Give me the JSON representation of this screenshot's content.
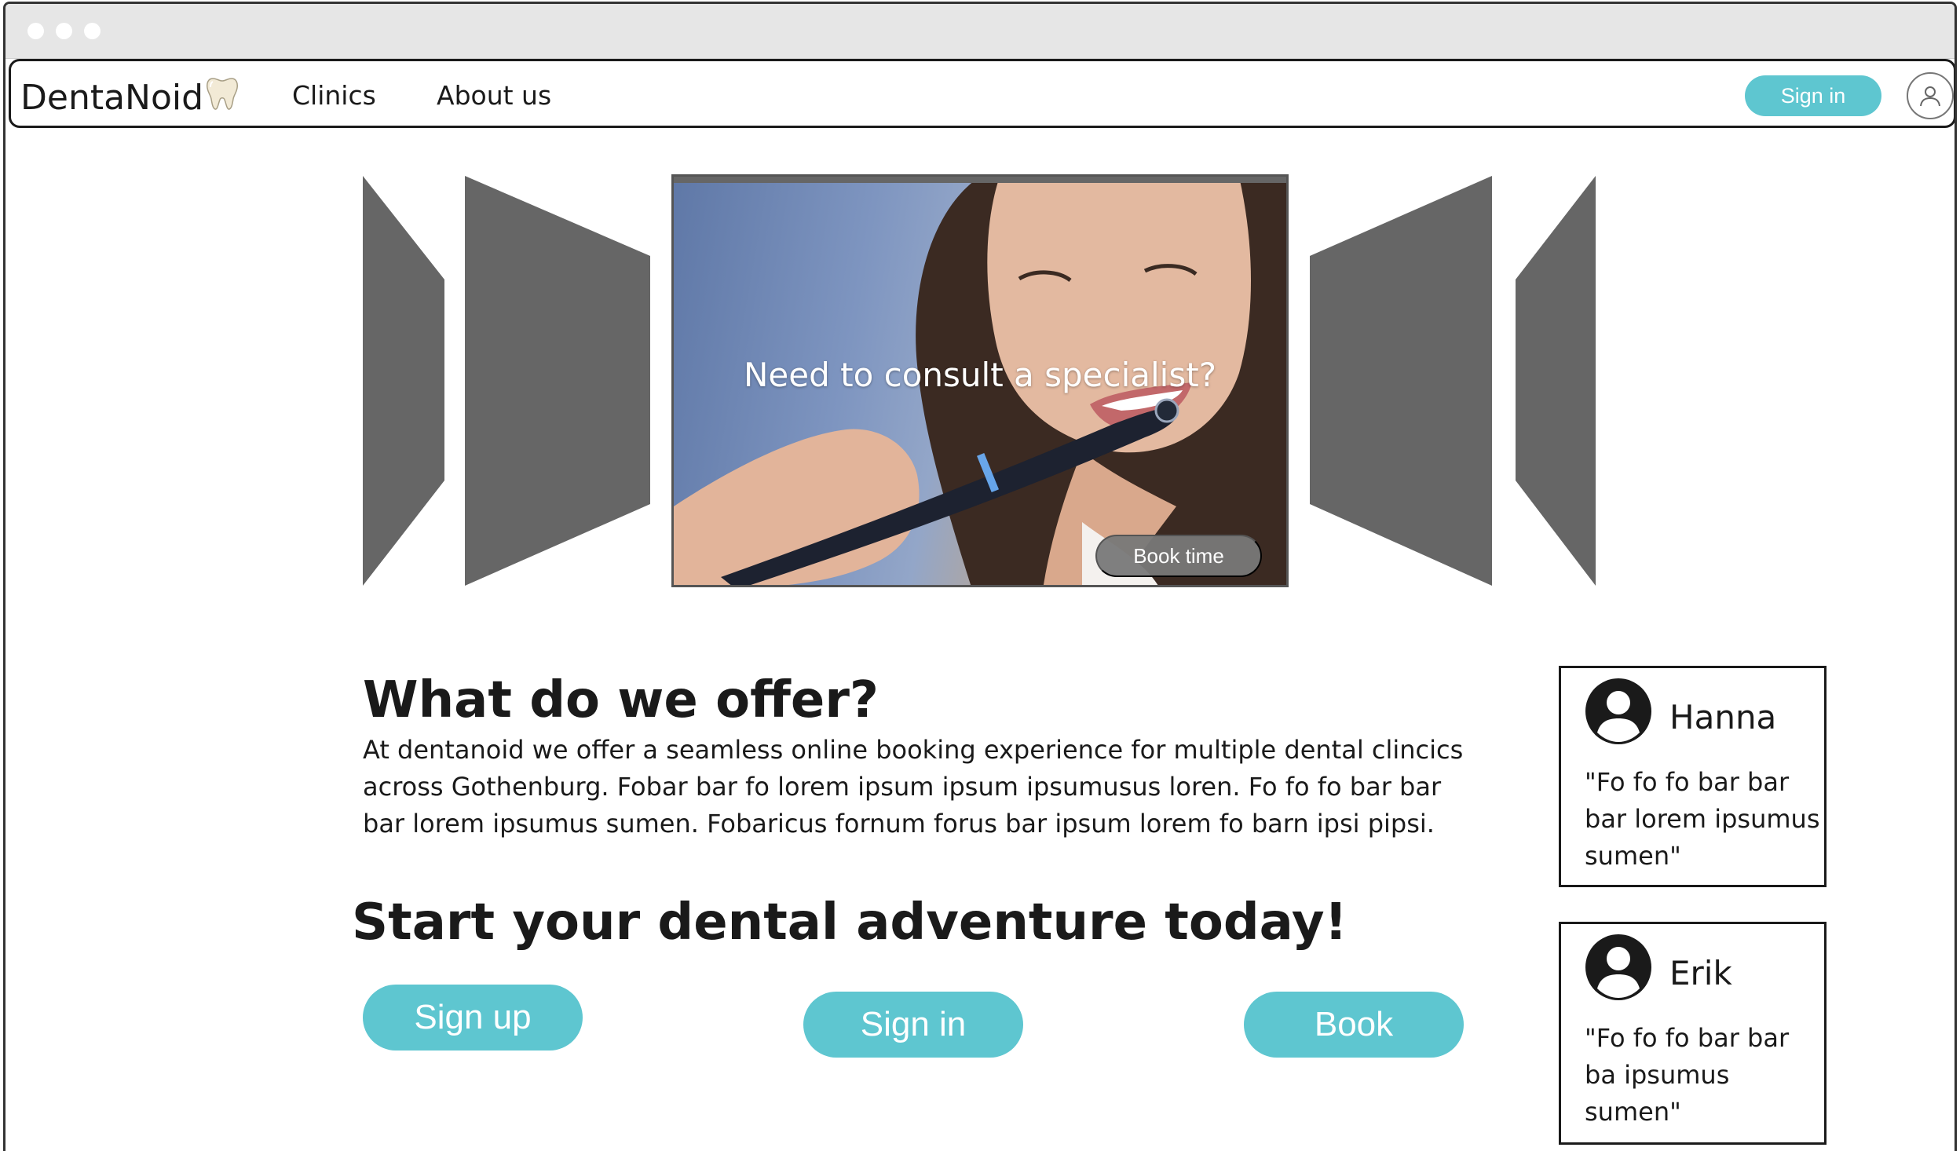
{
  "app": {
    "brand": "DentaNoid",
    "brand_icon": "tooth-icon"
  },
  "nav": {
    "links": [
      {
        "label": "Clinics"
      },
      {
        "label": "About us"
      }
    ],
    "signin_label": "Sign in",
    "avatar_icon": "user-icon"
  },
  "carousel": {
    "headline": "Need to consult a  specialist?",
    "book_label": "Book time"
  },
  "offer": {
    "title": "What do we offer?",
    "text": "At dentanoid we offer a seamless online booking experience for multiple dental clincics across Gothenburg. Fobar bar fo lorem ipsum ipsum ipsumusus loren. Fo fo fo bar bar bar lorem ipsumus sumen. Fobaricus fornum forus bar ipsum lorem fo barn ipsi pipsi."
  },
  "adventure": {
    "title": "Start your dental adventure today!",
    "buttons": {
      "signup": "Sign up",
      "signin": "Sign in",
      "book": "Book"
    }
  },
  "reviews": [
    {
      "name": "Hanna",
      "quote": "\"Fo fo fo bar bar bar lorem ipsumus sumen\""
    },
    {
      "name": "Erik",
      "quote": "\"Fo fo fo bar bar ba ipsumus sumen\""
    }
  ],
  "colors": {
    "accent": "#5ec6d0",
    "carousel_panel": "#666666"
  }
}
